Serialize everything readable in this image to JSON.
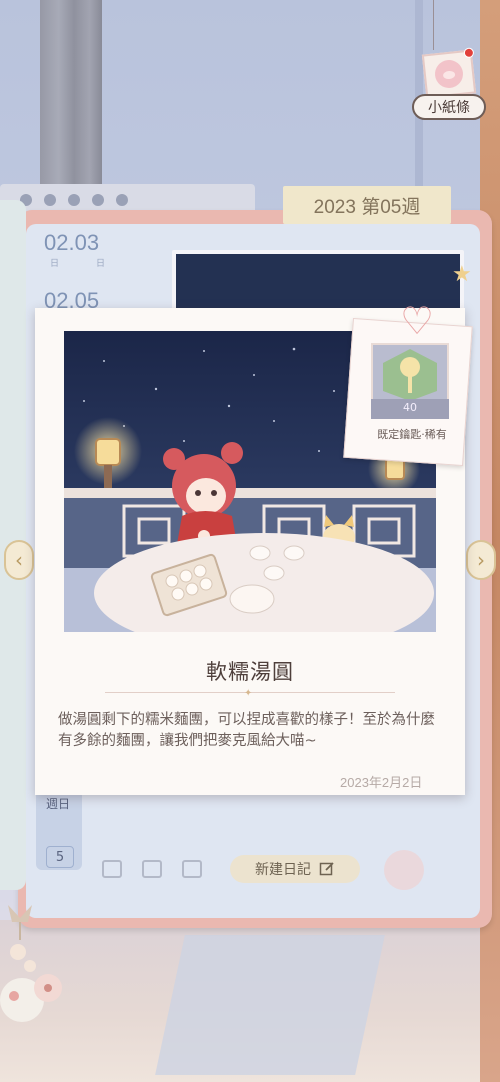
{
  "header": {
    "note_label": "小紙條",
    "week_tab": "2023 第05週"
  },
  "calendar": {
    "date_top": "02.03",
    "date_bottom": "02.05",
    "sub_top": "日",
    "sub_mid": "日",
    "day_label": "週日",
    "day_number": "5"
  },
  "entry": {
    "title": "軟糯湯圓",
    "description": "做湯圓剩下的糯米麵團，可以捏成喜歡的樣子！至於為什麼有多餘的麵團，讓我們把麥克風給大喵~",
    "date": "2023年2月2日"
  },
  "reward": {
    "count": "40",
    "label": "既定鑰匙·稀有"
  },
  "actions": {
    "new_diary": "新建日記",
    "prev_arrow": "‹",
    "next_arrow": "›"
  },
  "icons": {
    "heart": "heart-icon",
    "edit": "edit-icon",
    "star": "star-icon"
  },
  "colors": {
    "journal_frame": "#eab8b0",
    "journal_inner": "#dfe6f2",
    "night_sky": "#1f2d52",
    "card": "#fcf9f6"
  }
}
